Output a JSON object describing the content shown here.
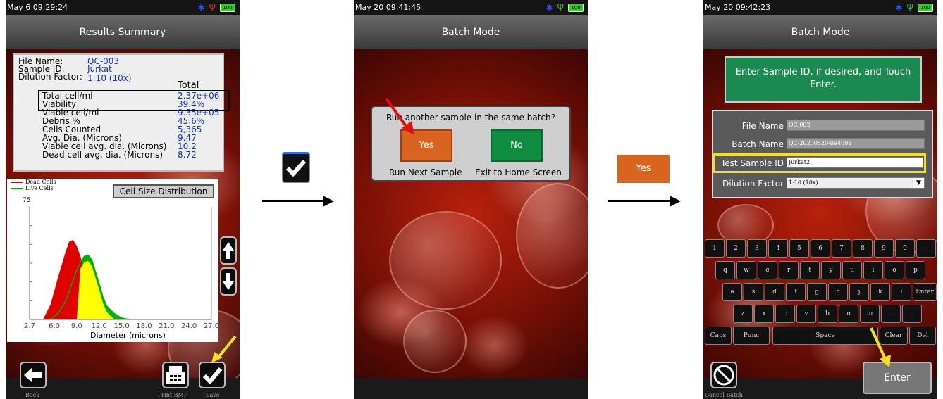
{
  "screen1": {
    "status_time": "May  6 09:29:24",
    "title": "Results Summary",
    "file_name_label": "File Name:",
    "file_name_value": "QC-003",
    "sample_id_label": "Sample ID:",
    "sample_id_value": "Jurkat",
    "dilution_label": "Dilution Factor:",
    "dilution_value": "1:10 (10x)",
    "total_header": "Total",
    "results": [
      {
        "label": "Total cell/ml",
        "value": "2.37e+06"
      },
      {
        "label": "Viability",
        "value": "39.4%"
      },
      {
        "label": "Viable cell/ml",
        "value": "9.35e+05"
      },
      {
        "label": "Debris %",
        "value": "45.6%"
      },
      {
        "label": "Cells Counted",
        "value": "5,365"
      },
      {
        "label": "Avg. Dia. (Microns)",
        "value": "9.47"
      },
      {
        "label": "Viable cell avg. dia. (Microns)",
        "value": "10.2"
      },
      {
        "label": "Dead cell avg. dia. (Microns)",
        "value": "8.72"
      }
    ],
    "legend_dead": "Dead Cells",
    "legend_live": "Live Cells",
    "chart_button": "Cell Size Distribution",
    "y_max_label": "75",
    "x_ticks": [
      "2.7",
      "6.0",
      "9.0",
      "12.0",
      "15.0",
      "18.0",
      "21.0",
      "24.0",
      "27.0"
    ],
    "x_label": "Diameter (microns)",
    "back_label": "Back",
    "print_label": "Print BMP",
    "save_label": "Save",
    "colors": {
      "dead": "#e00000",
      "live": "#00b000",
      "overlap": "#ffff00",
      "value_text": "#1030d0"
    }
  },
  "chart_data": {
    "type": "area",
    "title": "",
    "xlabel": "Diameter (microns)",
    "ylabel": "",
    "xlim": [
      2.7,
      27.0
    ],
    "ylim": [
      0,
      75
    ],
    "series": [
      {
        "name": "Dead Cells",
        "x": [
          4.5,
          5.5,
          6.5,
          7.5,
          8.0,
          8.5,
          9.0,
          9.5,
          10.0,
          10.5,
          11.0,
          11.5,
          12.0,
          12.5,
          13.0,
          14.0
        ],
        "values": [
          0,
          10,
          28,
          45,
          52,
          53,
          49,
          42,
          33,
          22,
          14,
          8,
          4,
          2,
          1,
          0
        ]
      },
      {
        "name": "Live Cells",
        "x": [
          5.5,
          6.5,
          7.5,
          8.5,
          9.0,
          9.5,
          10.0,
          10.5,
          11.0,
          11.5,
          12.0,
          12.5,
          13.0,
          14.0,
          15.0,
          16.0
        ],
        "values": [
          0,
          4,
          12,
          26,
          33,
          38,
          42,
          43,
          40,
          32,
          24,
          15,
          9,
          4,
          1,
          0
        ]
      }
    ]
  },
  "transition1": {
    "check_icon": "check-icon"
  },
  "screen2": {
    "status_time": "May 20 09:41:45",
    "title": "Batch Mode",
    "dialog_question": "Run another sample in the same batch?",
    "yes_label": "Yes",
    "no_label": "No",
    "yes_caption": "Run Next Sample",
    "no_caption": "Exit to Home Screen"
  },
  "transition2": {
    "yes_label": "Yes"
  },
  "screen3": {
    "status_time": "May 20 09:42:23",
    "title": "Batch Mode",
    "instruction": "Enter Sample ID, if desired, and Touch Enter.",
    "file_name_label": "File Name",
    "file_name_value": "QC-002",
    "batch_name_label": "Batch Name",
    "batch_name_value": "QC-20200520-094008",
    "test_sample_label": "Test Sample ID",
    "test_sample_value": "Jurkat2_",
    "dilution_label": "Dilution Factor",
    "dilution_value": "1:10 (10x)",
    "keyboard": {
      "row1": [
        "1",
        "2",
        "3",
        "4",
        "5",
        "6",
        "7",
        "8",
        "9",
        "0",
        "-"
      ],
      "row2": [
        "q",
        "w",
        "e",
        "r",
        "t",
        "y",
        "u",
        "i",
        "o",
        "p"
      ],
      "row3": [
        "a",
        "s",
        "d",
        "f",
        "g",
        "h",
        "j",
        "k",
        "l",
        "Enter"
      ],
      "row4": [
        "z",
        "x",
        "c",
        "v",
        "b",
        "n",
        "m",
        ".",
        "_"
      ],
      "row5": [
        "Caps",
        "Punc",
        "Space",
        "Clear",
        "Del"
      ]
    },
    "enter_label": "Enter",
    "cancel_label": "Cancel Batch"
  }
}
